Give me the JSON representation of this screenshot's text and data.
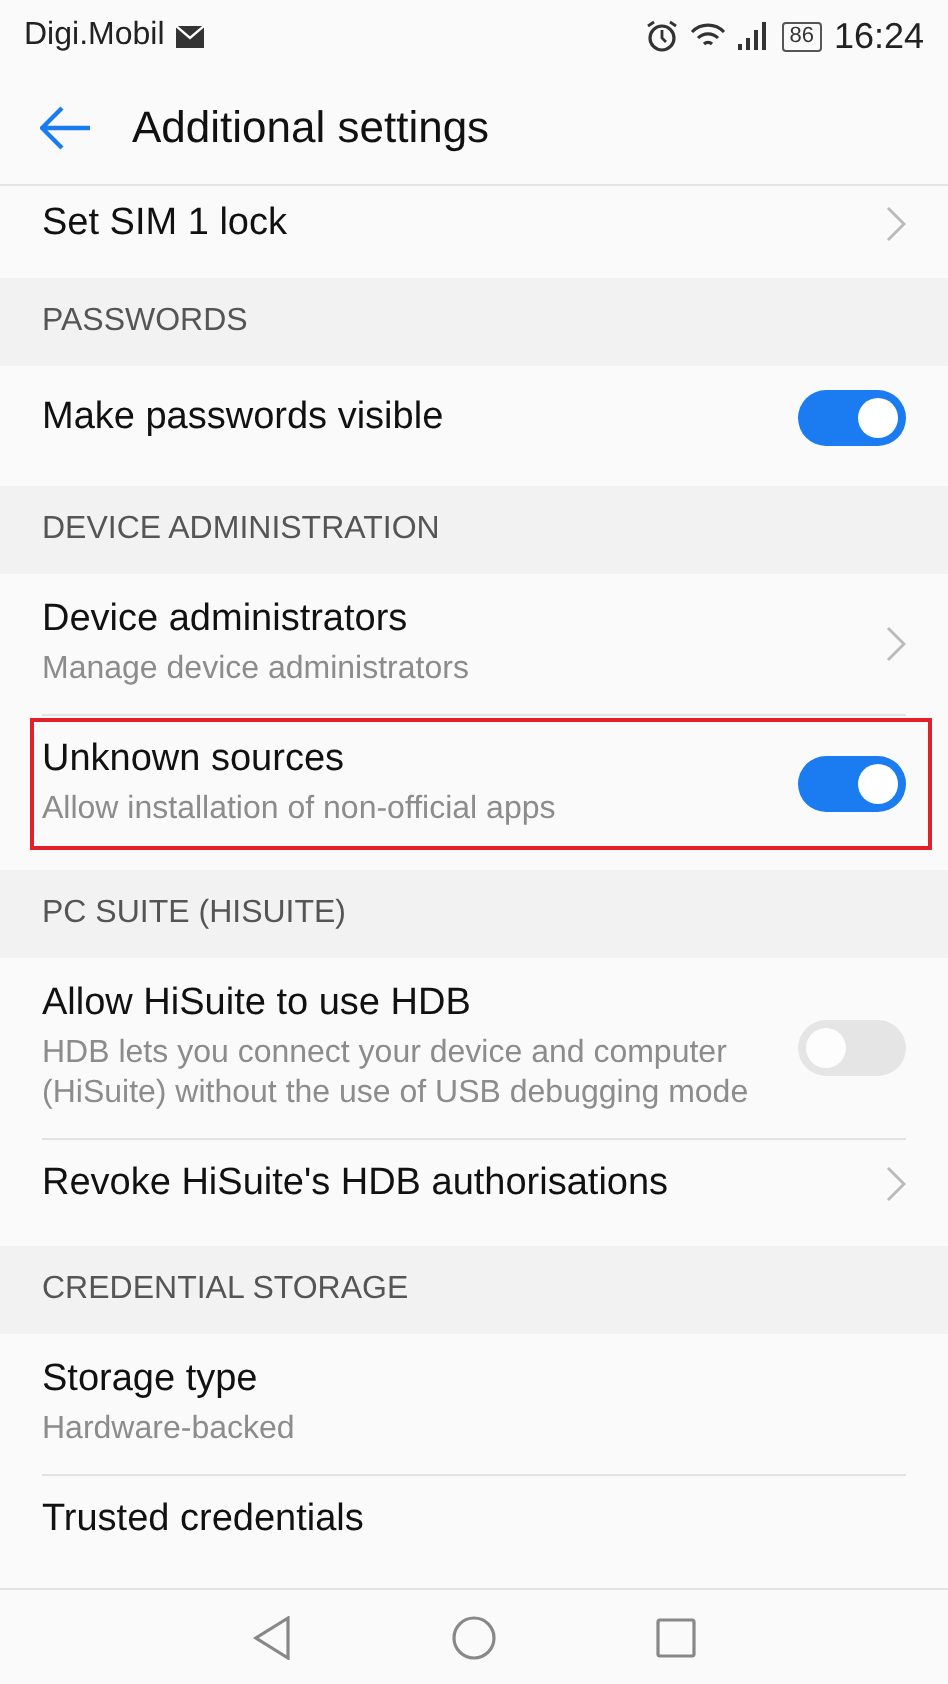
{
  "status_bar": {
    "carrier": "Digi.Mobil",
    "battery": "86",
    "time": "16:24"
  },
  "app_bar": {
    "title": "Additional settings"
  },
  "sections": [
    {
      "items": [
        {
          "kind": "link",
          "title": "Set SIM 1 lock"
        }
      ]
    },
    {
      "header": "PASSWORDS",
      "items": [
        {
          "kind": "switch",
          "title": "Make passwords visible",
          "on": true,
          "disabled": false
        }
      ]
    },
    {
      "header": "DEVICE ADMINISTRATION",
      "items": [
        {
          "kind": "link",
          "title": "Device administrators",
          "subtitle": "Manage device administrators"
        },
        {
          "kind": "switch",
          "title": "Unknown sources",
          "subtitle": "Allow installation of non-official apps",
          "on": true,
          "disabled": false,
          "highlighted": true
        }
      ]
    },
    {
      "header": "PC SUITE (HISUITE)",
      "items": [
        {
          "kind": "switch",
          "title": "Allow HiSuite to use HDB",
          "subtitle": "HDB lets you connect your device and computer (HiSuite) without the use of USB debugging mode",
          "on": false,
          "disabled": true
        },
        {
          "kind": "link",
          "title": "Revoke HiSuite's HDB authorisations"
        }
      ]
    },
    {
      "header": "CREDENTIAL STORAGE",
      "items": [
        {
          "kind": "info",
          "title": "Storage type",
          "subtitle": "Hardware-backed"
        },
        {
          "kind": "info",
          "title": "Trusted credentials"
        }
      ]
    }
  ]
}
